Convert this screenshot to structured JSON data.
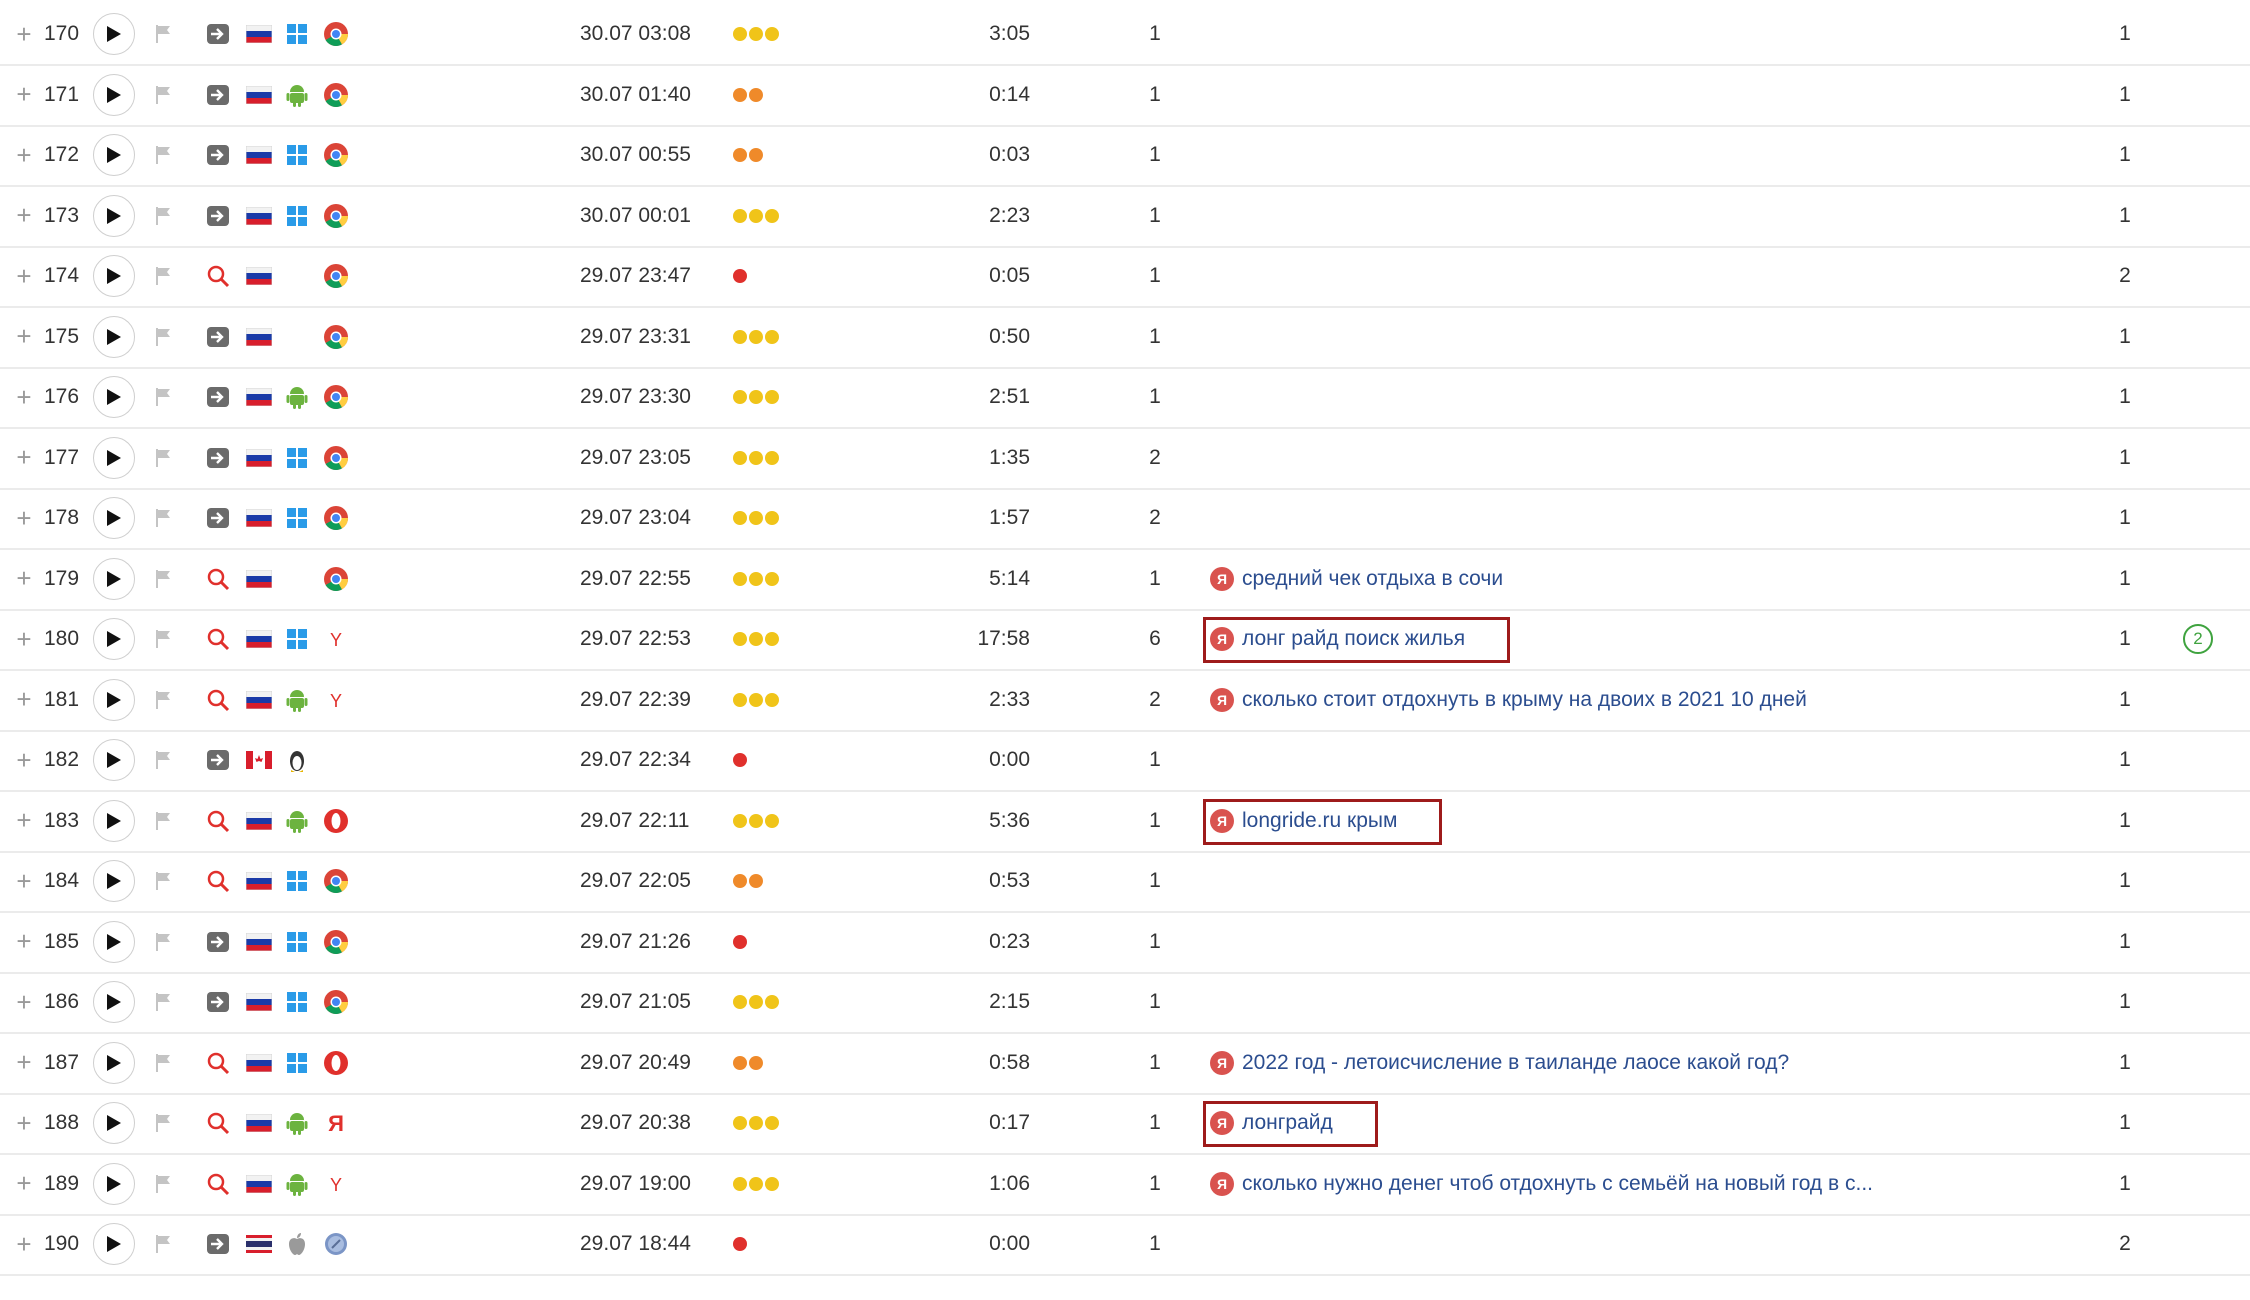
{
  "colors": {
    "dot_green": "#f0c419",
    "dot_orange": "#ef8a2a",
    "dot_red": "#e0302c",
    "link": "#2b4d8f",
    "highlight": "#9e1b1b"
  },
  "rows": [
    {
      "n": "170",
      "src": "direct",
      "country": "ru",
      "os": "windows",
      "browser": "chrome",
      "date": "30.07 03:08",
      "depth": 3,
      "duration": "3:05",
      "views": "1",
      "phrase": "",
      "visits": "1",
      "extra": ""
    },
    {
      "n": "171",
      "src": "direct",
      "country": "ru",
      "os": "android",
      "browser": "chrome",
      "date": "30.07 01:40",
      "depth": 2,
      "duration": "0:14",
      "views": "1",
      "phrase": "",
      "visits": "1",
      "extra": ""
    },
    {
      "n": "172",
      "src": "direct",
      "country": "ru",
      "os": "windows",
      "browser": "chrome",
      "date": "30.07 00:55",
      "depth": 2,
      "duration": "0:03",
      "views": "1",
      "phrase": "",
      "visits": "1",
      "extra": ""
    },
    {
      "n": "173",
      "src": "direct",
      "country": "ru",
      "os": "windows",
      "browser": "chrome",
      "date": "30.07 00:01",
      "depth": 3,
      "duration": "2:23",
      "views": "1",
      "phrase": "",
      "visits": "1",
      "extra": ""
    },
    {
      "n": "174",
      "src": "search",
      "country": "ru",
      "os": "",
      "browser": "chrome",
      "date": "29.07 23:47",
      "depth": 1,
      "duration": "0:05",
      "views": "1",
      "phrase": "",
      "visits": "2",
      "extra": ""
    },
    {
      "n": "175",
      "src": "direct",
      "country": "ru",
      "os": "",
      "browser": "chrome",
      "date": "29.07 23:31",
      "depth": 3,
      "duration": "0:50",
      "views": "1",
      "phrase": "",
      "visits": "1",
      "extra": ""
    },
    {
      "n": "176",
      "src": "direct",
      "country": "ru",
      "os": "android",
      "browser": "chrome",
      "date": "29.07 23:30",
      "depth": 3,
      "duration": "2:51",
      "views": "1",
      "phrase": "",
      "visits": "1",
      "extra": ""
    },
    {
      "n": "177",
      "src": "direct",
      "country": "ru",
      "os": "windows",
      "browser": "chrome",
      "date": "29.07 23:05",
      "depth": 3,
      "duration": "1:35",
      "views": "2",
      "phrase": "",
      "visits": "1",
      "extra": ""
    },
    {
      "n": "178",
      "src": "direct",
      "country": "ru",
      "os": "windows",
      "browser": "chrome",
      "date": "29.07 23:04",
      "depth": 3,
      "duration": "1:57",
      "views": "2",
      "phrase": "",
      "visits": "1",
      "extra": ""
    },
    {
      "n": "179",
      "src": "search",
      "country": "ru",
      "os": "",
      "browser": "chrome",
      "date": "29.07 22:55",
      "depth": 3,
      "duration": "5:14",
      "views": "1",
      "phrase": "средний чек отдыха в сочи",
      "visits": "1",
      "extra": ""
    },
    {
      "n": "180",
      "src": "search",
      "country": "ru",
      "os": "windows",
      "browser": "yabrowser",
      "date": "29.07 22:53",
      "depth": 3,
      "duration": "17:58",
      "views": "6",
      "phrase": "лонг райд поиск жилья",
      "visits": "1",
      "extra": "2",
      "hl": true
    },
    {
      "n": "181",
      "src": "search",
      "country": "ru",
      "os": "android",
      "browser": "yabrowser",
      "date": "29.07 22:39",
      "depth": 3,
      "duration": "2:33",
      "views": "2",
      "phrase": "сколько стоит отдохнуть в крыму на двоих в 2021 10 дней",
      "visits": "1",
      "extra": ""
    },
    {
      "n": "182",
      "src": "direct",
      "country": "ca",
      "os": "linux",
      "browser": "",
      "date": "29.07 22:34",
      "depth": 1,
      "duration": "0:00",
      "views": "1",
      "phrase": "",
      "visits": "1",
      "extra": ""
    },
    {
      "n": "183",
      "src": "search",
      "country": "ru",
      "os": "android",
      "browser": "opera",
      "date": "29.07 22:11",
      "depth": 3,
      "duration": "5:36",
      "views": "1",
      "phrase": "longride.ru крым",
      "visits": "1",
      "extra": "",
      "hl": true
    },
    {
      "n": "184",
      "src": "search",
      "country": "ru",
      "os": "windows",
      "browser": "chrome",
      "date": "29.07 22:05",
      "depth": 2,
      "duration": "0:53",
      "views": "1",
      "phrase": "",
      "visits": "1",
      "extra": ""
    },
    {
      "n": "185",
      "src": "direct",
      "country": "ru",
      "os": "windows",
      "browser": "chrome",
      "date": "29.07 21:26",
      "depth": 1,
      "duration": "0:23",
      "views": "1",
      "phrase": "",
      "visits": "1",
      "extra": ""
    },
    {
      "n": "186",
      "src": "direct",
      "country": "ru",
      "os": "windows",
      "browser": "chrome",
      "date": "29.07 21:05",
      "depth": 3,
      "duration": "2:15",
      "views": "1",
      "phrase": "",
      "visits": "1",
      "extra": ""
    },
    {
      "n": "187",
      "src": "search",
      "country": "ru",
      "os": "windows",
      "browser": "opera",
      "date": "29.07 20:49",
      "depth": 2,
      "duration": "0:58",
      "views": "1",
      "phrase": "2022 год - летоисчисление в таиланде лаосе какой год?",
      "visits": "1",
      "extra": ""
    },
    {
      "n": "188",
      "src": "search",
      "country": "ru",
      "os": "android",
      "browser": "yandex",
      "date": "29.07 20:38",
      "depth": 3,
      "duration": "0:17",
      "views": "1",
      "phrase": "лонграйд",
      "visits": "1",
      "extra": "",
      "hl": true
    },
    {
      "n": "189",
      "src": "search",
      "country": "ru",
      "os": "android",
      "browser": "yabrowser",
      "date": "29.07 19:00",
      "depth": 3,
      "duration": "1:06",
      "views": "1",
      "phrase": "сколько нужно денег чтоб отдохнуть с семьёй на новый год в с...",
      "visits": "1",
      "extra": ""
    },
    {
      "n": "190",
      "src": "direct",
      "country": "th",
      "os": "apple",
      "browser": "safari",
      "date": "29.07 18:44",
      "depth": 1,
      "duration": "0:00",
      "views": "1",
      "phrase": "",
      "visits": "2",
      "extra": ""
    }
  ]
}
